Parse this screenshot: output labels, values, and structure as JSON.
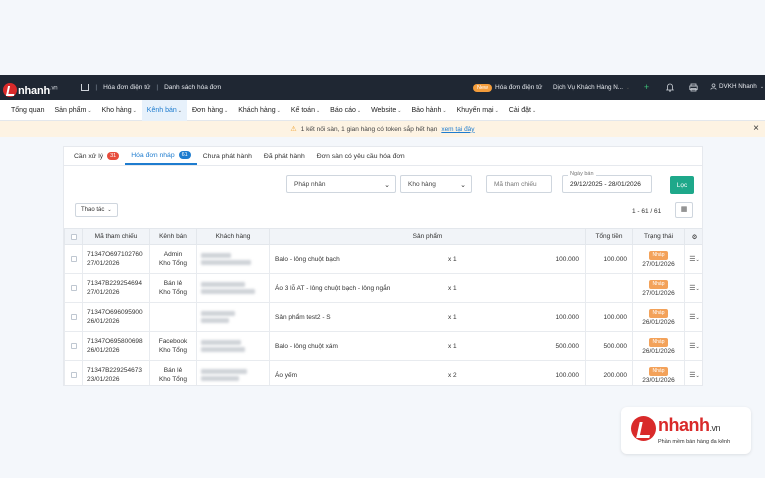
{
  "topbar": {
    "logo_word": "nhanh",
    "logo_suffix": ".vn",
    "breadcrumb": [
      "Hóa đơn điện tử",
      "Danh sách hóa đơn"
    ],
    "new_badge": "New",
    "einvoice_link": "Hóa đơn điện tử",
    "service_dropdown": "Dịch Vụ Khách Hàng N...",
    "user_name": "DVKH Nhanh"
  },
  "menu": [
    {
      "label": "Tổng quan",
      "caret": false
    },
    {
      "label": "Sản phẩm",
      "caret": true
    },
    {
      "label": "Kho hàng",
      "caret": true
    },
    {
      "label": "Kênh bán",
      "caret": true,
      "active": true
    },
    {
      "label": "Đơn hàng",
      "caret": true
    },
    {
      "label": "Khách hàng",
      "caret": true
    },
    {
      "label": "Kế toán",
      "caret": true
    },
    {
      "label": "Báo cáo",
      "caret": true
    },
    {
      "label": "Website",
      "caret": true
    },
    {
      "label": "Bảo hành",
      "caret": true
    },
    {
      "label": "Khuyến mại",
      "caret": true
    },
    {
      "label": "Cài đặt",
      "caret": true
    }
  ],
  "notice": {
    "text": "1 kết nối sàn, 1 gian hàng có token sắp hết hạn",
    "link": "xem tại đây"
  },
  "tabs": [
    {
      "label": "Cần xử lý",
      "count": "31",
      "count_color": "red"
    },
    {
      "label": "Hóa đơn nháp",
      "count": "61",
      "count_color": "blue",
      "active": true
    },
    {
      "label": "Chưa phát hành"
    },
    {
      "label": "Đã phát hành"
    },
    {
      "label": "Đơn sàn có yêu cầu hóa đơn"
    }
  ],
  "filters": {
    "legal_entity_placeholder": "Pháp nhân",
    "warehouse_placeholder": "Kho hàng",
    "ref_code_placeholder": "Mã tham chiếu",
    "date_label": "Ngày bán",
    "date_value": "29/12/2025 - 28/01/2026",
    "filter_button": "Lọc"
  },
  "actions_button": "Thao tác",
  "pagination": "1 - 61 / 61",
  "table": {
    "headers": [
      "Mã tham chiếu",
      "Kênh bán",
      "Khách hàng",
      "Sản phẩm",
      "Tổng tiền",
      "Trạng thái"
    ],
    "rows": [
      {
        "code": "71347O697102760",
        "date": "27/01/2026",
        "channel1": "Admin",
        "channel2": "Kho Tổng",
        "product": "Balo - lông chuột bạch",
        "qty": "x 1",
        "price": "100.000",
        "total": "100.000",
        "status": "Nháp",
        "status_date": "27/01/2026"
      },
      {
        "code": "71347B229254694",
        "date": "27/01/2026",
        "channel1": "Bán lẻ",
        "channel2": "Kho Tổng",
        "product": "Áo 3 lỗ AT - lông chuột bạch - lông ngắn",
        "qty": "x 1",
        "price": "",
        "total": "",
        "status": "Nháp",
        "status_date": "27/01/2026"
      },
      {
        "code": "71347O696095900",
        "date": "26/01/2026",
        "channel1": "",
        "channel2": "",
        "product": "Sản phẩm test2 - S",
        "qty": "x 1",
        "price": "100.000",
        "total": "100.000",
        "status": "Nháp",
        "status_date": "26/01/2026"
      },
      {
        "code": "71347O695800698",
        "date": "26/01/2026",
        "channel1": "Facebook",
        "channel2": "Kho Tổng",
        "product": "Balo - lông chuột xám",
        "qty": "x 1",
        "price": "500.000",
        "total": "500.000",
        "status": "Nháp",
        "status_date": "26/01/2026"
      },
      {
        "code": "71347B229254673",
        "date": "23/01/2026",
        "channel1": "Bán lẻ",
        "channel2": "Kho Tổng",
        "product": "Áo yếm",
        "qty": "x 2",
        "price": "100.000",
        "total": "200.000",
        "status": "Nháp",
        "status_date": "23/01/2026"
      }
    ]
  },
  "brand_card": {
    "word": "nhanh",
    "suffix": ".vn",
    "tagline": "Phần mềm bán hàng đa kênh"
  },
  "colors": {
    "accent": "#1e7ccf",
    "dark_bar": "#1f2733",
    "filter_button": "#1ea88a",
    "draft_badge": "#f3a25a",
    "brand_red": "#d92a2a"
  }
}
